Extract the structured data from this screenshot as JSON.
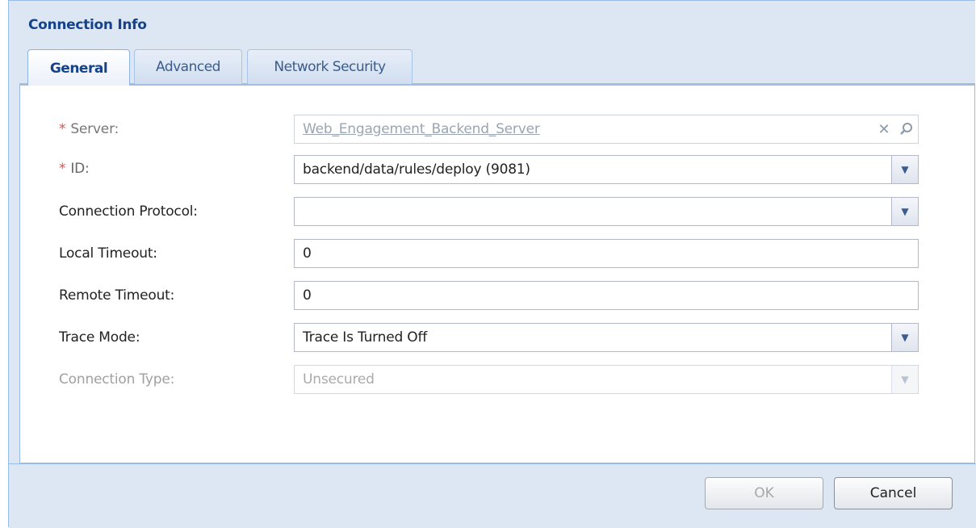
{
  "dialog": {
    "title": "Connection Info",
    "tabs": [
      {
        "label": "General",
        "active": true
      },
      {
        "label": "Advanced",
        "active": false
      },
      {
        "label": "Network Security",
        "active": false
      }
    ]
  },
  "form": {
    "required_marker": "*",
    "server": {
      "label": "Server:",
      "value": "Web_Engagement_Backend_Server",
      "required": true
    },
    "id": {
      "label": "ID:",
      "value": "backend/data/rules/deploy (9081)",
      "required": true
    },
    "connection_protocol": {
      "label": "Connection Protocol:",
      "value": ""
    },
    "local_timeout": {
      "label": "Local Timeout:",
      "value": "0"
    },
    "remote_timeout": {
      "label": "Remote Timeout:",
      "value": "0"
    },
    "trace_mode": {
      "label": "Trace Mode:",
      "value": "Trace Is Turned Off"
    },
    "connection_type": {
      "label": "Connection Type:",
      "value": "Unsecured",
      "disabled": true
    }
  },
  "buttons": {
    "ok": "OK",
    "cancel": "Cancel"
  },
  "icons": {
    "clear": "clear-icon",
    "search": "search-icon",
    "dropdown": "chevron-down-icon"
  },
  "colors": {
    "title": "#15428b",
    "required": "#d9534f",
    "panel_header": "#dde7f3",
    "border": "#99bbe8"
  }
}
